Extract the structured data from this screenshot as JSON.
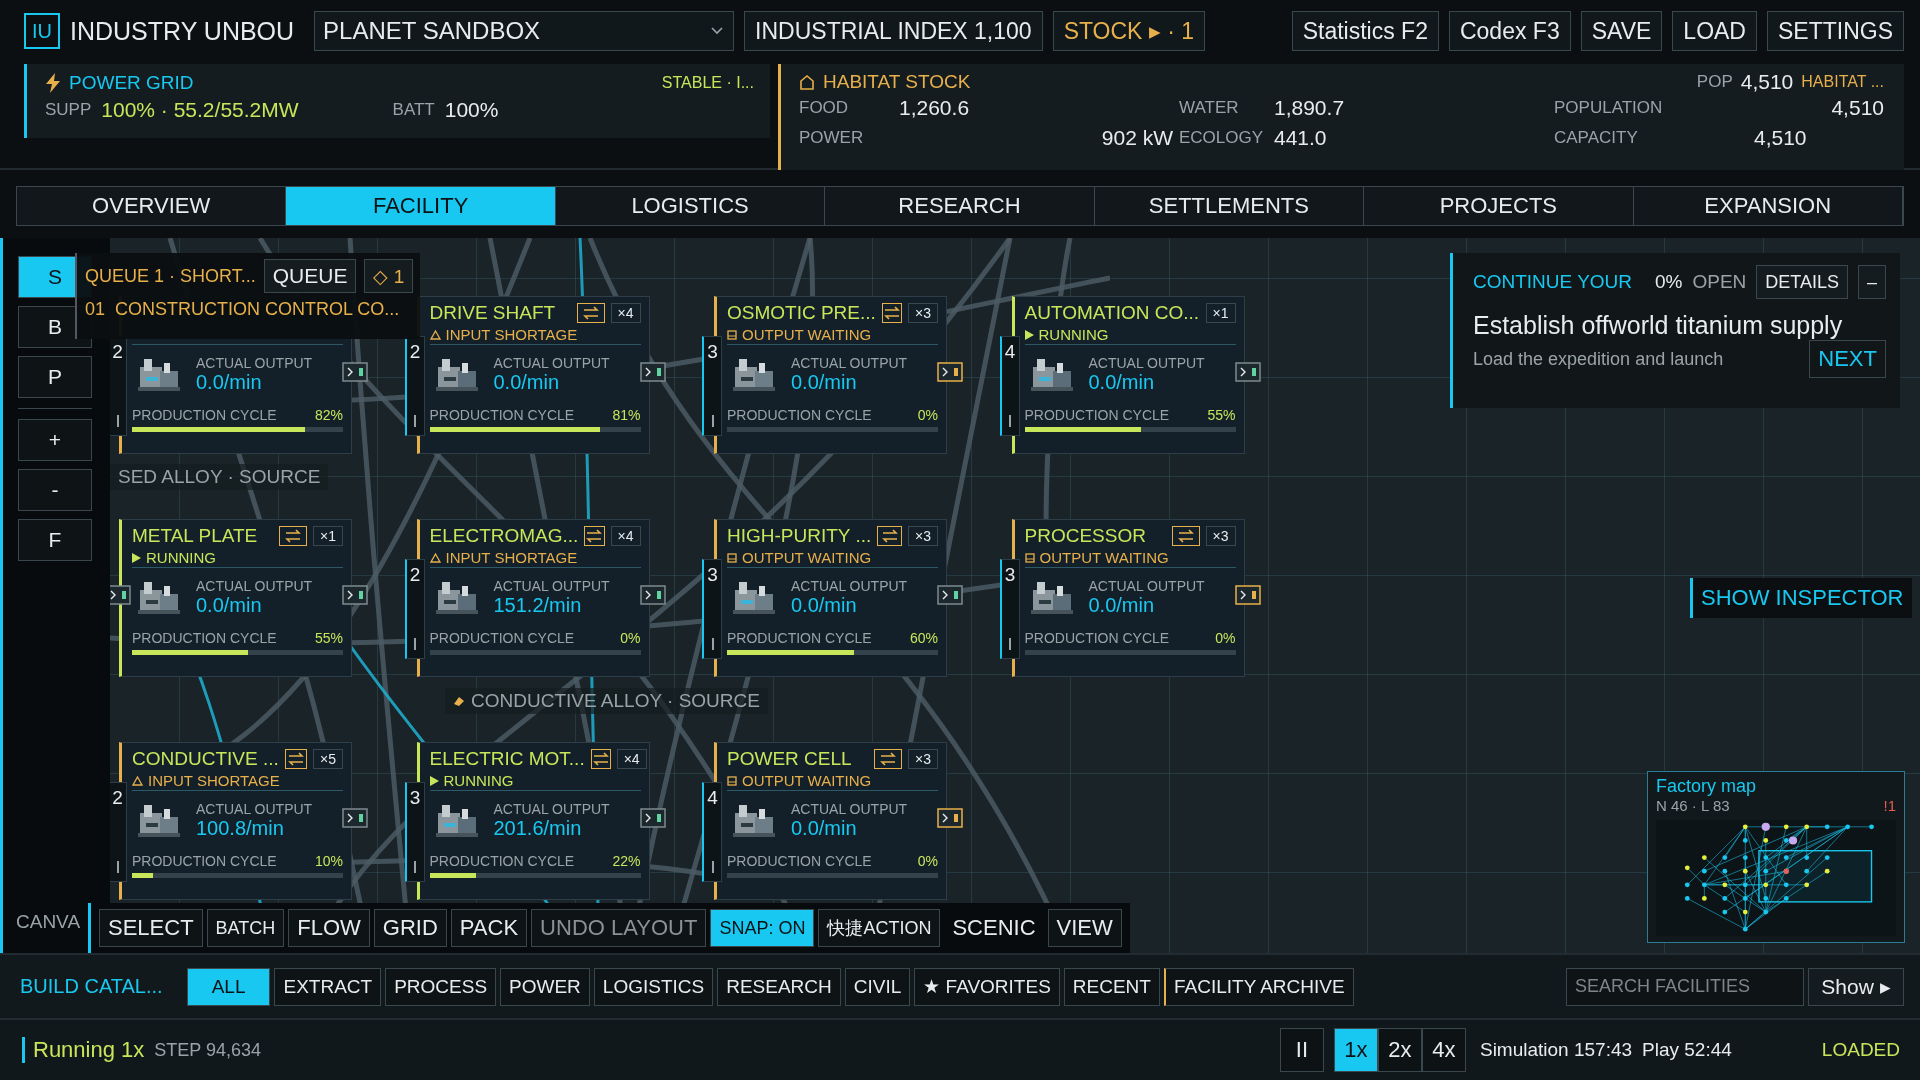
{
  "app": {
    "logo": "IU",
    "title": "INDUSTRY UNBOU",
    "world": "PLANET SANDBOX",
    "index": "INDUSTRIAL INDEX 1,100",
    "stock": "STOCK ▸ · 1"
  },
  "top_buttons": [
    "Statistics F2",
    "Codex F3",
    "SAVE",
    "LOAD",
    "SETTINGS"
  ],
  "power_grid": {
    "title": "POWER GRID",
    "status": "STABLE · I...",
    "supply_label": "SUPP",
    "supply": "100% · 55.2/55.2MW",
    "battery_label": "BATT",
    "battery": "100%"
  },
  "habitat": {
    "title": "HABITAT STOCK",
    "pop_label": "POP",
    "pop": "4,510",
    "tag": "HABITAT ...",
    "stats": [
      {
        "label": "FOOD",
        "value": "1,260.6"
      },
      {
        "label": "WATER",
        "value": "1,890.7"
      },
      {
        "label": "POPULATION",
        "value": "4,510"
      },
      {
        "label": "POWER",
        "value": "902 kW"
      },
      {
        "label": "ECOLOGY",
        "value": "441.0"
      },
      {
        "label": "CAPACITY",
        "value": "4,510"
      }
    ]
  },
  "tabs": [
    {
      "label": "OVERVIEW",
      "selected": false
    },
    {
      "label": "FACILITY",
      "selected": true
    },
    {
      "label": "LOGISTICS",
      "selected": false
    },
    {
      "label": "RESEARCH",
      "selected": false
    },
    {
      "label": "SETTLEMENTS",
      "selected": false
    },
    {
      "label": "PROJECTS",
      "selected": false
    },
    {
      "label": "EXPANSION",
      "selected": false
    }
  ],
  "tools": [
    {
      "label": "S",
      "selected": true
    },
    {
      "label": "B",
      "selected": false
    },
    {
      "label": "P",
      "selected": false
    },
    {
      "label": "+",
      "selected": false
    },
    {
      "label": "-",
      "selected": false
    },
    {
      "label": "F",
      "selected": false
    }
  ],
  "queue": {
    "title": "QUEUE 1 · SHORT...",
    "button": "QUEUE",
    "count": "◇ 1",
    "item": "01  CONSTRUCTION CONTROL CO..."
  },
  "canvas_labels": [
    "SED ALLOY · SOURCE",
    "CONDUCTIVE ALLOY · SOURCE"
  ],
  "facility_rows": [
    [
      {
        "swap": false,
        "tier": "2",
        "output_label": "ACTUAL OUTPUT",
        "output": "0.0/min",
        "cycle_label": "PRODUCTION CYCLE",
        "cycle": "82%",
        "level": 0.82,
        "port_alert": false,
        "input_port": false
      },
      {
        "title": "DRIVE SHAFT",
        "multiplier": "×4",
        "swap": true,
        "status": {
          "kind": "input_shortage",
          "text": "INPUT SHORTAGE"
        },
        "tier": "2",
        "output_label": "ACTUAL OUTPUT",
        "output": "0.0/min",
        "cycle_label": "PRODUCTION CYCLE",
        "cycle": "81%",
        "level": 0.81,
        "port_alert": false,
        "input_port": false
      },
      {
        "title": "OSMOTIC PRE...",
        "multiplier": "×3",
        "swap": true,
        "status": {
          "kind": "output_waiting",
          "text": "OUTPUT WAITING"
        },
        "tier": "3",
        "output_label": "ACTUAL OUTPUT",
        "output": "0.0/min",
        "cycle_label": "PRODUCTION CYCLE",
        "cycle": "0%",
        "level": 0,
        "port_alert": true,
        "input_port": false
      },
      {
        "title": "AUTOMATION CO...",
        "multiplier": "×1",
        "swap": false,
        "status": {
          "kind": "running",
          "text": "RUNNING"
        },
        "tier": "4",
        "output_label": "ACTUAL OUTPUT",
        "output": "0.0/min",
        "cycle_label": "PRODUCTION CYCLE",
        "cycle": "55%",
        "level": 0.55,
        "port_alert": false,
        "input_port": false
      }
    ],
    [
      {
        "title": "METAL PLATE",
        "multiplier": "×1",
        "swap": true,
        "status": {
          "kind": "running",
          "text": "RUNNING"
        },
        "output_label": "ACTUAL OUTPUT",
        "output": "0.0/min",
        "cycle_label": "PRODUCTION CYCLE",
        "cycle": "55%",
        "level": 0.55,
        "port_alert": false,
        "input_port": true
      },
      {
        "title": "ELECTROMAG...",
        "multiplier": "×4",
        "swap": true,
        "status": {
          "kind": "input_shortage",
          "text": "INPUT SHORTAGE"
        },
        "tier": "2",
        "output_label": "ACTUAL OUTPUT",
        "output": "151.2/min",
        "cycle_label": "PRODUCTION CYCLE",
        "cycle": "0%",
        "level": 0,
        "port_alert": false,
        "input_port": false
      },
      {
        "title": "HIGH-PURITY ...",
        "multiplier": "×3",
        "swap": true,
        "status": {
          "kind": "output_waiting",
          "text": "OUTPUT WAITING"
        },
        "tier": "3",
        "output_label": "ACTUAL OUTPUT",
        "output": "0.0/min",
        "cycle_label": "PRODUCTION CYCLE",
        "cycle": "60%",
        "level": 0.6,
        "port_alert": false,
        "input_port": false
      },
      {
        "title": "PROCESSOR",
        "multiplier": "×3",
        "swap": true,
        "status": {
          "kind": "output_waiting",
          "text": "OUTPUT WAITING"
        },
        "tier": "3",
        "output_label": "ACTUAL OUTPUT",
        "output": "0.0/min",
        "cycle_label": "PRODUCTION CYCLE",
        "cycle": "0%",
        "level": 0,
        "port_alert": true,
        "input_port": false
      }
    ],
    [
      {
        "title": "CONDUCTIVE ...",
        "multiplier": "×5",
        "swap": true,
        "status": {
          "kind": "input_shortage",
          "text": "INPUT SHORTAGE"
        },
        "tier": "2",
        "output_label": "ACTUAL OUTPUT",
        "output": "100.8/min",
        "cycle_label": "PRODUCTION CYCLE",
        "cycle": "10%",
        "level": 0.1,
        "port_alert": false,
        "input_port": false
      },
      {
        "title": "ELECTRIC MOT...",
        "multiplier": "×4",
        "swap": true,
        "status": {
          "kind": "running",
          "text": "RUNNING"
        },
        "tier": "3",
        "output_label": "ACTUAL OUTPUT",
        "output": "201.6/min",
        "cycle_label": "PRODUCTION CYCLE",
        "cycle": "22%",
        "level": 0.22,
        "port_alert": false,
        "input_port": false
      },
      {
        "title": "POWER CELL",
        "multiplier": "×3",
        "swap": true,
        "status": {
          "kind": "output_waiting",
          "text": "OUTPUT WAITING"
        },
        "tier": "4",
        "output_label": "ACTUAL OUTPUT",
        "output": "0.0/min",
        "cycle_label": "PRODUCTION CYCLE",
        "cycle": "0%",
        "level": 0,
        "port_alert": true,
        "input_port": false
      }
    ]
  ],
  "mission": {
    "label": "CONTINUE YOUR",
    "progress": "0%",
    "state": "OPEN",
    "details": "DETAILS",
    "collapse": "–",
    "title": "Establish offworld titanium supply",
    "subtitle": "Load the expedition and launch",
    "next": "NEXT"
  },
  "inspector_button": "SHOW INSPECTOR",
  "factory_map": {
    "title": "Factory map",
    "stats": "N 46 · L 83",
    "alerts": "!1"
  },
  "canvas_label": "CANVA",
  "canvas_tools": [
    {
      "label": "SELECT",
      "kind": "button",
      "selected": false,
      "disabled": false
    },
    {
      "label": "BATCH",
      "kind": "compact",
      "selected": false,
      "disabled": false
    },
    {
      "label": "FLOW",
      "kind": "button",
      "selected": false,
      "disabled": false
    },
    {
      "label": "GRID",
      "kind": "button",
      "selected": false,
      "disabled": false
    },
    {
      "label": "PACK",
      "kind": "button",
      "selected": false,
      "disabled": false
    },
    {
      "label": "UNDO LAYOUT",
      "kind": "button",
      "selected": false,
      "disabled": true
    },
    {
      "label": "SNAP: ON",
      "kind": "compact",
      "selected": true,
      "disabled": false
    },
    {
      "label": "快捷ACTION",
      "kind": "compact",
      "selected": false,
      "disabled": false
    },
    {
      "label": "SCENIC",
      "kind": "plain",
      "selected": false,
      "disabled": false
    },
    {
      "label": "VIEW",
      "kind": "button",
      "selected": false,
      "disabled": false
    }
  ],
  "catalog": {
    "title": "BUILD CATAL...",
    "categories": [
      {
        "label": "ALL",
        "selected": true,
        "kind": "chip"
      },
      {
        "label": "EXTRACT",
        "selected": false,
        "kind": "chip"
      },
      {
        "label": "PROCESS",
        "selected": false,
        "kind": "chip"
      },
      {
        "label": "POWER",
        "selected": false,
        "kind": "chip"
      },
      {
        "label": "LOGISTICS",
        "selected": false,
        "kind": "chip"
      },
      {
        "label": "RESEARCH",
        "selected": false,
        "kind": "chip"
      },
      {
        "label": "CIVIL",
        "selected": false,
        "kind": "chip"
      },
      {
        "label": "★ FAVORITES",
        "selected": false,
        "kind": "chip"
      },
      {
        "label": "RECENT",
        "selected": false,
        "kind": "chip"
      },
      {
        "label": "FACILITY ARCHIVE",
        "selected": false,
        "kind": "archive"
      }
    ],
    "search": {
      "placeholder": "SEARCH FACILITIES"
    },
    "show": "Show ▸"
  },
  "status_bar": {
    "state": "Running 1x",
    "step": "STEP 94,634",
    "pause": "II",
    "speeds": [
      {
        "label": "1x",
        "selected": true
      },
      {
        "label": "2x",
        "selected": false
      },
      {
        "label": "4x",
        "selected": false
      }
    ],
    "simulation": "Simulation 157:43",
    "play": "Play 52:44",
    "load_state": "LOADED"
  }
}
